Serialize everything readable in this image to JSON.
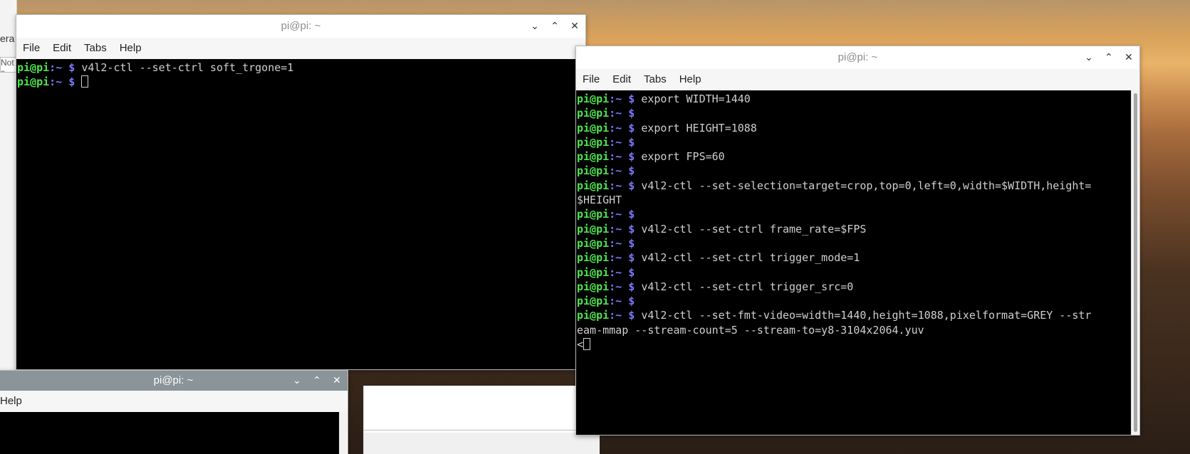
{
  "background": {
    "left_fragment_1": "era",
    "left_fragment_2": "Not s"
  },
  "windows": [
    {
      "id": "terminal-top-left",
      "title": "pi@pi: ~",
      "menu": [
        "File",
        "Edit",
        "Tabs",
        "Help"
      ],
      "lines": [
        {
          "user": "pi@pi",
          "path": ":~",
          "sym": " $ ",
          "cmd": "v4l2-ctl --set-ctrl soft_trgone=1"
        },
        {
          "user": "pi@pi",
          "path": ":~",
          "sym": " $ ",
          "cmd": "",
          "cursor": true
        }
      ]
    },
    {
      "id": "terminal-right",
      "title": "pi@pi: ~",
      "menu": [
        "File",
        "Edit",
        "Tabs",
        "Help"
      ],
      "lines": [
        {
          "user": "pi@pi",
          "path": ":~",
          "sym": " $ ",
          "cmd": "export WIDTH=1440"
        },
        {
          "user": "pi@pi",
          "path": ":~",
          "sym": " $ ",
          "cmd": ""
        },
        {
          "user": "pi@pi",
          "path": ":~",
          "sym": " $ ",
          "cmd": "export HEIGHT=1088"
        },
        {
          "user": "pi@pi",
          "path": ":~",
          "sym": " $ ",
          "cmd": ""
        },
        {
          "user": "pi@pi",
          "path": ":~",
          "sym": " $ ",
          "cmd": "export FPS=60"
        },
        {
          "user": "pi@pi",
          "path": ":~",
          "sym": " $ ",
          "cmd": ""
        },
        {
          "user": "pi@pi",
          "path": ":~",
          "sym": " $ ",
          "cmd": "v4l2-ctl --set-selection=target=crop,top=0,left=0,width=$WIDTH,height="
        },
        {
          "text": "$HEIGHT"
        },
        {
          "user": "pi@pi",
          "path": ":~",
          "sym": " $ ",
          "cmd": ""
        },
        {
          "user": "pi@pi",
          "path": ":~",
          "sym": " $ ",
          "cmd": "v4l2-ctl --set-ctrl frame_rate=$FPS"
        },
        {
          "user": "pi@pi",
          "path": ":~",
          "sym": " $ ",
          "cmd": ""
        },
        {
          "user": "pi@pi",
          "path": ":~",
          "sym": " $ ",
          "cmd": "v4l2-ctl --set-ctrl trigger_mode=1"
        },
        {
          "user": "pi@pi",
          "path": ":~",
          "sym": " $ ",
          "cmd": ""
        },
        {
          "user": "pi@pi",
          "path": ":~",
          "sym": " $ ",
          "cmd": "v4l2-ctl --set-ctrl trigger_src=0"
        },
        {
          "user": "pi@pi",
          "path": ":~",
          "sym": " $ ",
          "cmd": ""
        },
        {
          "user": "pi@pi",
          "path": ":~",
          "sym": " $ ",
          "cmd": "v4l2-ctl --set-fmt-video=width=1440,height=1088,pixelformat=GREY --str"
        },
        {
          "text": "eam-mmap --stream-count=5 --stream-to=y8-3104x2064.yuv"
        },
        {
          "text": "<",
          "cursor": true
        }
      ]
    },
    {
      "id": "terminal-bottom-left",
      "title": "pi@pi: ~",
      "menu": [
        "Help"
      ],
      "lines": []
    }
  ],
  "icons": {
    "minimize": "chevron-down-icon",
    "maximize": "chevron-up-icon",
    "close": "close-icon"
  }
}
